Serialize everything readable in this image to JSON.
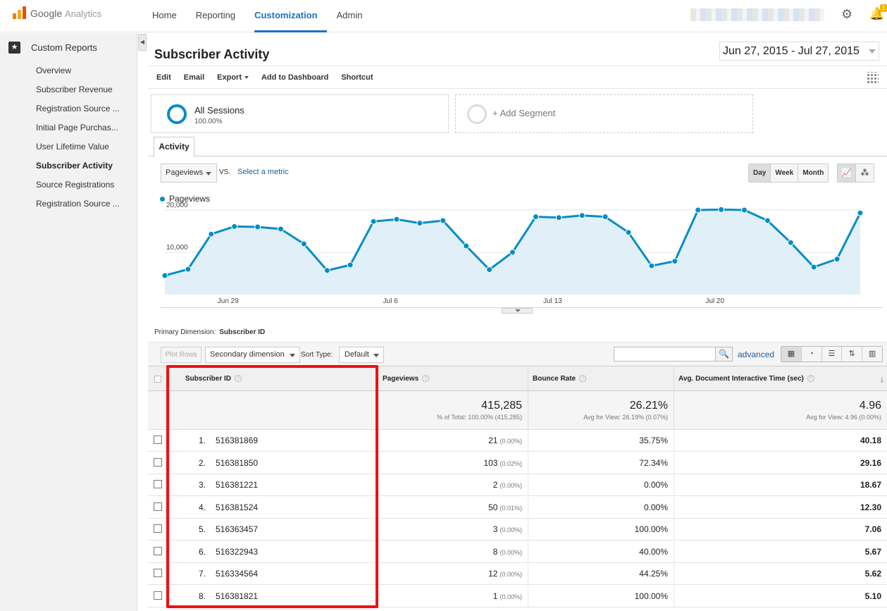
{
  "app": {
    "brand": "Google",
    "product": "Analytics",
    "notification_count": "1"
  },
  "nav": [
    {
      "label": "Home",
      "active": false
    },
    {
      "label": "Reporting",
      "active": false
    },
    {
      "label": "Customization",
      "active": true
    },
    {
      "label": "Admin",
      "active": false
    }
  ],
  "sidebar": {
    "header": "Custom Reports",
    "items": [
      {
        "label": "Overview"
      },
      {
        "label": "Subscriber Revenue"
      },
      {
        "label": "Registration Source ..."
      },
      {
        "label": "Initial Page Purchas..."
      },
      {
        "label": "User Lifetime Value"
      },
      {
        "label": "Subscriber Activity"
      },
      {
        "label": "Source Registrations"
      },
      {
        "label": "Registration Source ..."
      }
    ]
  },
  "page": {
    "title": "Subscriber Activity",
    "date_range": "Jun 27, 2015 - Jul 27, 2015"
  },
  "toolbar": {
    "edit": "Edit",
    "email": "Email",
    "export": "Export",
    "add_dashboard": "Add to Dashboard",
    "shortcut": "Shortcut"
  },
  "segments": {
    "active_name": "All Sessions",
    "active_pct": "100.00%",
    "add": "+ Add Segment"
  },
  "tab": "Activity",
  "metric": {
    "selected": "Pageviews",
    "vs": "VS.",
    "select_metric": "Select a metric"
  },
  "period": {
    "day": "Day",
    "week": "Week",
    "month": "Month"
  },
  "chart_data": {
    "type": "area",
    "series": [
      {
        "name": "Pageviews",
        "values": [
          4500,
          6000,
          14300,
          16100,
          16000,
          15500,
          12000,
          5700,
          7000,
          17300,
          17800,
          16900,
          17500,
          11500,
          5900,
          10000,
          18400,
          18200,
          18700,
          18400,
          14700,
          6800,
          7900,
          20000,
          20100,
          20000,
          17500,
          12300,
          6500,
          8400,
          19300
        ]
      }
    ],
    "x_tick_labels": [
      "Jun 29",
      "Jul 6",
      "Jul 13",
      "Jul 20"
    ],
    "x_tick_index": [
      2,
      9,
      16,
      23
    ],
    "y_ticks": [
      {
        "value": 10000,
        "label": "10,000"
      },
      {
        "value": 20000,
        "label": "20,000"
      }
    ],
    "ylim": [
      0,
      20000
    ],
    "color": "#058dc7",
    "fill": "#e1f0f8",
    "grid": true,
    "legend_position": "top-left"
  },
  "primary_dimension": {
    "label": "Primary Dimension:",
    "value": "Subscriber ID"
  },
  "table_controls": {
    "plot_rows": "Plot Rows",
    "secondary_dimension": "Secondary dimension",
    "sort_type_label": "Sort Type:",
    "sort_type": "Default",
    "advanced": "advanced"
  },
  "table": {
    "columns": [
      "Subscriber ID",
      "Pageviews",
      "Bounce Rate",
      "Avg. Document Interactive Time (sec)"
    ],
    "totals": {
      "pageviews": "415,285",
      "pageviews_sub": "% of Total: 100.00% (415,285)",
      "bounce_rate": "26.21%",
      "bounce_rate_sub": "Avg for View: 26.19% (0.07%)",
      "avg_time": "4.96",
      "avg_time_sub": "Avg for View: 4.96 (0.00%)"
    },
    "rows": [
      {
        "n": "1.",
        "id": "516381869",
        "pv": "21",
        "pvp": "(0.00%)",
        "br": "35.75%",
        "t": "40.18"
      },
      {
        "n": "2.",
        "id": "516381850",
        "pv": "103",
        "pvp": "(0.02%)",
        "br": "72.34%",
        "t": "29.16"
      },
      {
        "n": "3.",
        "id": "516381221",
        "pv": "2",
        "pvp": "(0.00%)",
        "br": "0.00%",
        "t": "18.67"
      },
      {
        "n": "4.",
        "id": "516381524",
        "pv": "50",
        "pvp": "(0.01%)",
        "br": "0.00%",
        "t": "12.30"
      },
      {
        "n": "5.",
        "id": "516363457",
        "pv": "3",
        "pvp": "(0.00%)",
        "br": "100.00%",
        "t": "7.06"
      },
      {
        "n": "6.",
        "id": "516322943",
        "pv": "8",
        "pvp": "(0.00%)",
        "br": "40.00%",
        "t": "5.67"
      },
      {
        "n": "7.",
        "id": "516334564",
        "pv": "12",
        "pvp": "(0.00%)",
        "br": "44.25%",
        "t": "5.62"
      },
      {
        "n": "8.",
        "id": "516381821",
        "pv": "1",
        "pvp": "(0.00%)",
        "br": "100.00%",
        "t": "5.10"
      }
    ]
  },
  "colors": {
    "accent": "#1a73c4",
    "chart_line": "#058dc7",
    "highlight": "#ee1111"
  }
}
